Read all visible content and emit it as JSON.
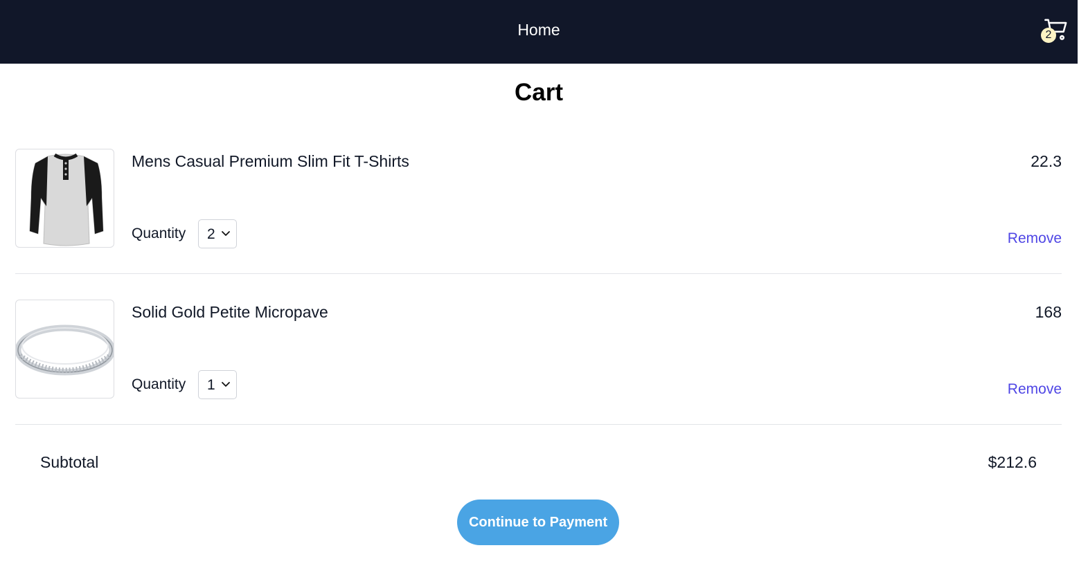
{
  "nav": {
    "home_label": "Home",
    "cart_count": "2"
  },
  "page": {
    "title": "Cart"
  },
  "cart": {
    "items": [
      {
        "name": "Mens Casual Premium Slim Fit T-Shirts",
        "price": "22.3",
        "quantity_label": "Quantity",
        "quantity": "2",
        "remove_label": "Remove",
        "image_icon": "tshirt-image"
      },
      {
        "name": "Solid Gold Petite Micropave",
        "price": "168",
        "quantity_label": "Quantity",
        "quantity": "1",
        "remove_label": "Remove",
        "image_icon": "ring-image"
      }
    ]
  },
  "summary": {
    "subtotal_label": "Subtotal",
    "subtotal_value": "$212.6",
    "continue_label": "Continue to Payment"
  },
  "colors": {
    "navbar": "#111729",
    "accent_link": "#4f46e5",
    "primary_button": "#4aa4e4",
    "badge": "#fdf3c4"
  }
}
